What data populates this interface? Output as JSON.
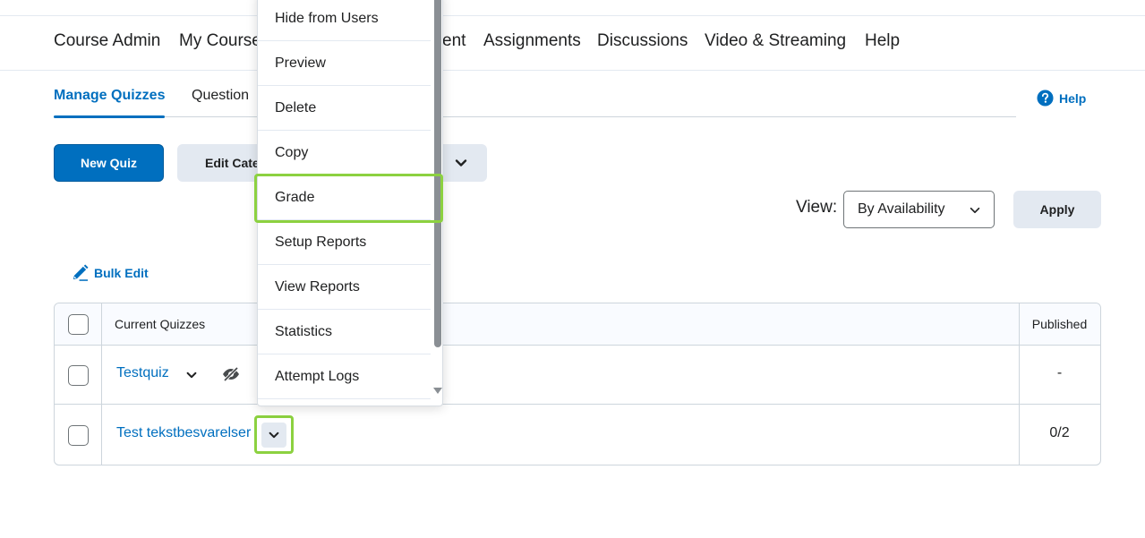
{
  "navbar": {
    "items": [
      "Course Admin",
      "My Course",
      "ent",
      "Assignments",
      "Discussions",
      "Video & Streaming",
      "Help"
    ]
  },
  "tabs": {
    "items": [
      {
        "label": "Manage Quizzes",
        "active": true
      },
      {
        "label": "Question",
        "active": false
      }
    ]
  },
  "help_link": {
    "label": "Help",
    "icon": "question-circle-icon"
  },
  "toolbar": {
    "new_quiz_label": "New Quiz",
    "edit_categories_label": "Edit Cate",
    "more_actions_icon": "chevron-down-icon"
  },
  "view": {
    "label": "View:",
    "selected": "By Availability",
    "apply_label": "Apply"
  },
  "bulk_edit": {
    "label": "Bulk Edit",
    "icon": "pencil-icon"
  },
  "table": {
    "headers": {
      "name": "Current Quizzes",
      "published": "Published"
    },
    "rows": [
      {
        "name": "Testquiz",
        "published": "-",
        "hidden_icon": "eye-slash-icon"
      },
      {
        "name": "Test tekstbesvarelser",
        "published": "0/2"
      }
    ]
  },
  "context_menu": {
    "items": [
      "Hide from Users",
      "Preview",
      "Delete",
      "Copy",
      "Grade",
      "Setup Reports",
      "View Reports",
      "Statistics",
      "Attempt Logs"
    ],
    "highlighted": "Grade"
  },
  "colors": {
    "accent": "#006fbf",
    "highlight_outline": "#8cd140",
    "secondary_button": "#e3e9f1"
  }
}
